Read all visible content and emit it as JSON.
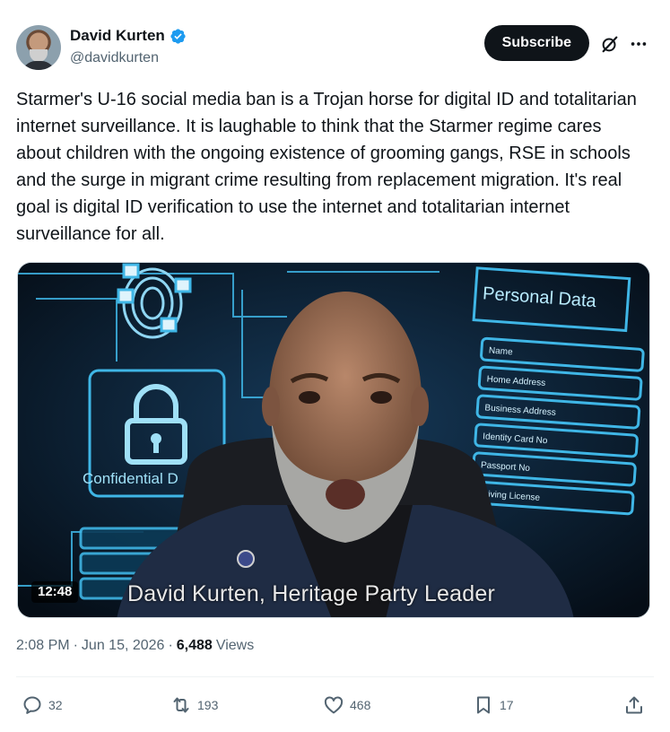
{
  "author": {
    "display_name": "David Kurten",
    "handle": "@davidkurten",
    "verified": true
  },
  "header": {
    "subscribe_label": "Subscribe",
    "grok_icon": "grok-slash-icon",
    "more_icon": "more-dots-icon"
  },
  "tweet": {
    "text": "Starmer's U-16 social media ban is a Trojan horse for digital ID and totalitarian internet surveillance. It is laughable to think that the Starmer regime cares about children with the ongoing existence of grooming gangs, RSE in schools and the surge in migrant crime resulting from replacement migration. It's real goal is digital ID verification to use the internet and totalitarian internet surveillance for all."
  },
  "video": {
    "duration": "12:48",
    "caption": "David Kurten, Heritage Party Leader",
    "panel_title": "Personal Data",
    "panel_fields": [
      "Name",
      "Home Address",
      "Business Address",
      "Identity Card No",
      "Passport No",
      "Driving License"
    ],
    "confidential_label": "Confidential D"
  },
  "meta": {
    "time": "2:08 PM",
    "date": "Jun 15, 2026",
    "separator": "·",
    "views_count": "6,488",
    "views_label": "Views"
  },
  "actions": {
    "replies": "32",
    "reposts": "193",
    "likes": "468",
    "bookmarks": "17"
  },
  "colors": {
    "text_primary": "#0f1419",
    "text_secondary": "#536471",
    "verified_blue": "#1d9bf0",
    "video_accent": "#3fb6e6"
  }
}
